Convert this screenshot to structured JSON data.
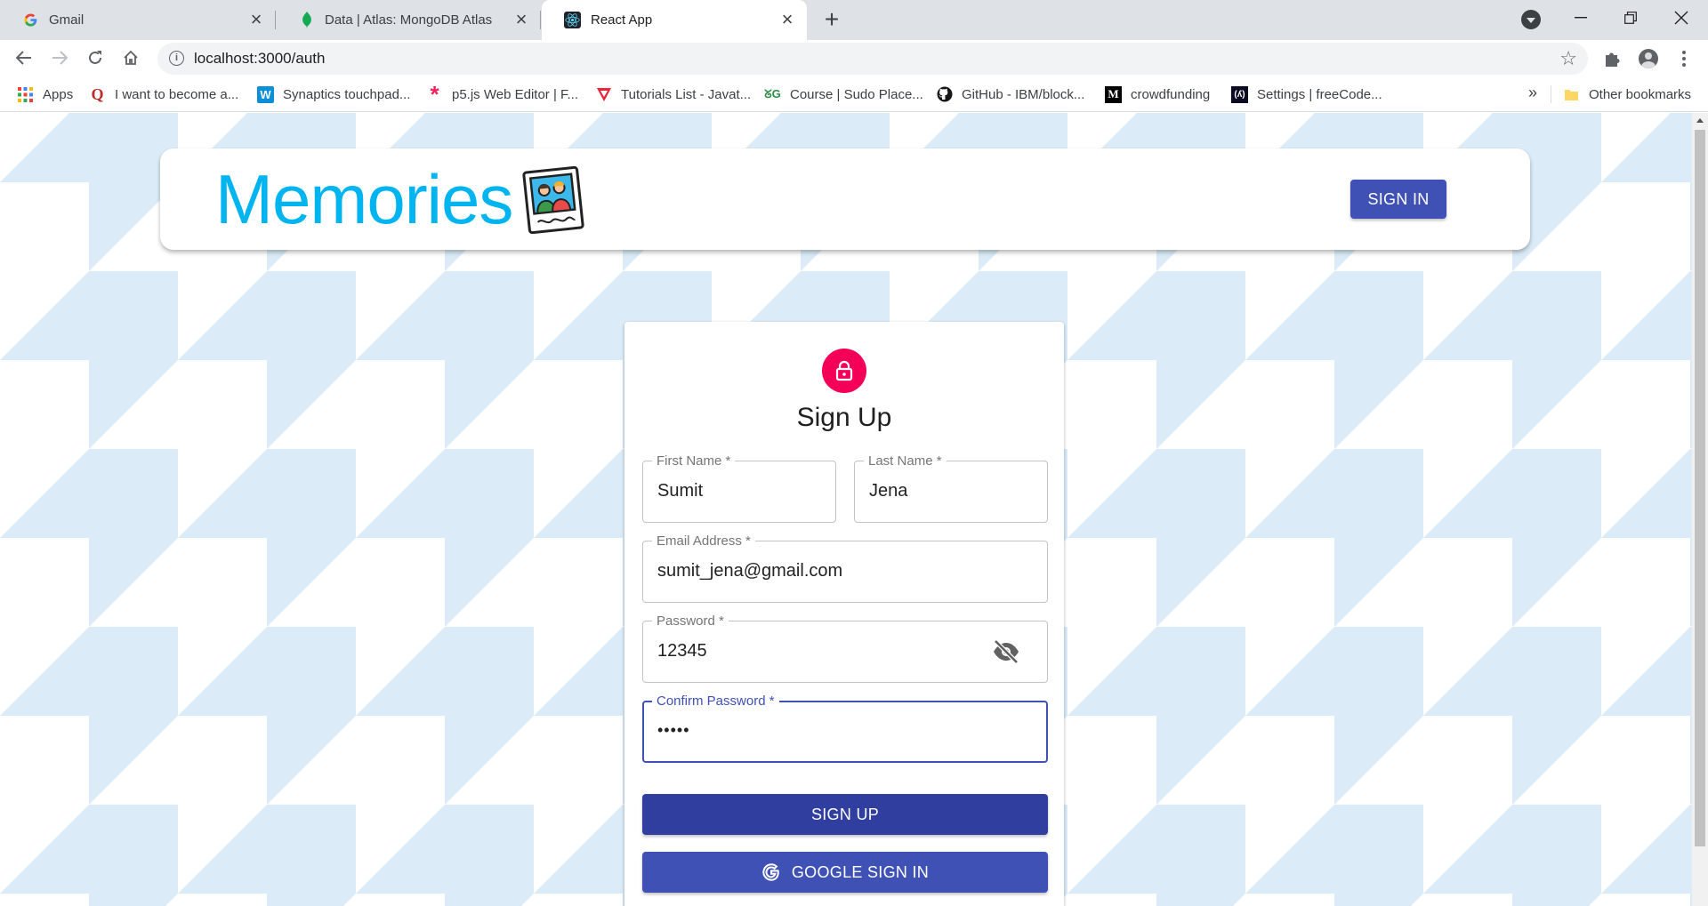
{
  "browser": {
    "tabs": [
      {
        "title": "Gmail",
        "icon": "google-icon"
      },
      {
        "title": "Data | Atlas: MongoDB Atlas",
        "icon": "mongodb-leaf-icon"
      },
      {
        "title": "React App",
        "icon": "react-icon"
      }
    ],
    "new_tab": "+",
    "url": "localhost:3000/auth",
    "bookmarks": [
      {
        "label": "Apps",
        "icon": "apps-grid-icon"
      },
      {
        "label": "I want to become a...",
        "icon": "quora-icon"
      },
      {
        "label": "Synaptics touchpad...",
        "icon": "w-icon"
      },
      {
        "label": "p5.js Web Editor | F...",
        "icon": "p5-asterisk-icon"
      },
      {
        "label": "Tutorials List - Javat...",
        "icon": "javatpoint-icon"
      },
      {
        "label": "Course | Sudo Place...",
        "icon": "gfg-icon"
      },
      {
        "label": "GitHub - IBM/block...",
        "icon": "github-icon"
      },
      {
        "label": "crowdfunding",
        "icon": "medium-icon"
      },
      {
        "label": "Settings | freeCode...",
        "icon": "freecodecamp-icon"
      }
    ],
    "bookmarks_more": "»",
    "other_bookmarks": "Other bookmarks"
  },
  "appbar": {
    "brand": "Memories",
    "sign_in": "SIGN IN"
  },
  "auth": {
    "title": "Sign Up",
    "first_name": {
      "label": "First Name *",
      "value": "Sumit"
    },
    "last_name": {
      "label": "Last Name *",
      "value": "Jena"
    },
    "email": {
      "label": "Email Address *",
      "value": "sumit_jena@gmail.com"
    },
    "password": {
      "label": "Password *",
      "value": "12345"
    },
    "confirm_password": {
      "label": "Confirm Password *",
      "value": "•••••"
    },
    "sign_up_button": "SIGN UP",
    "google_button": "GOOGLE SIGN IN"
  },
  "colors": {
    "brand": "#00b4ef",
    "primary": "#3f51b5",
    "primary_dark": "#303f9f",
    "avatar": "#f50057",
    "pattern": "#dbecf8"
  }
}
